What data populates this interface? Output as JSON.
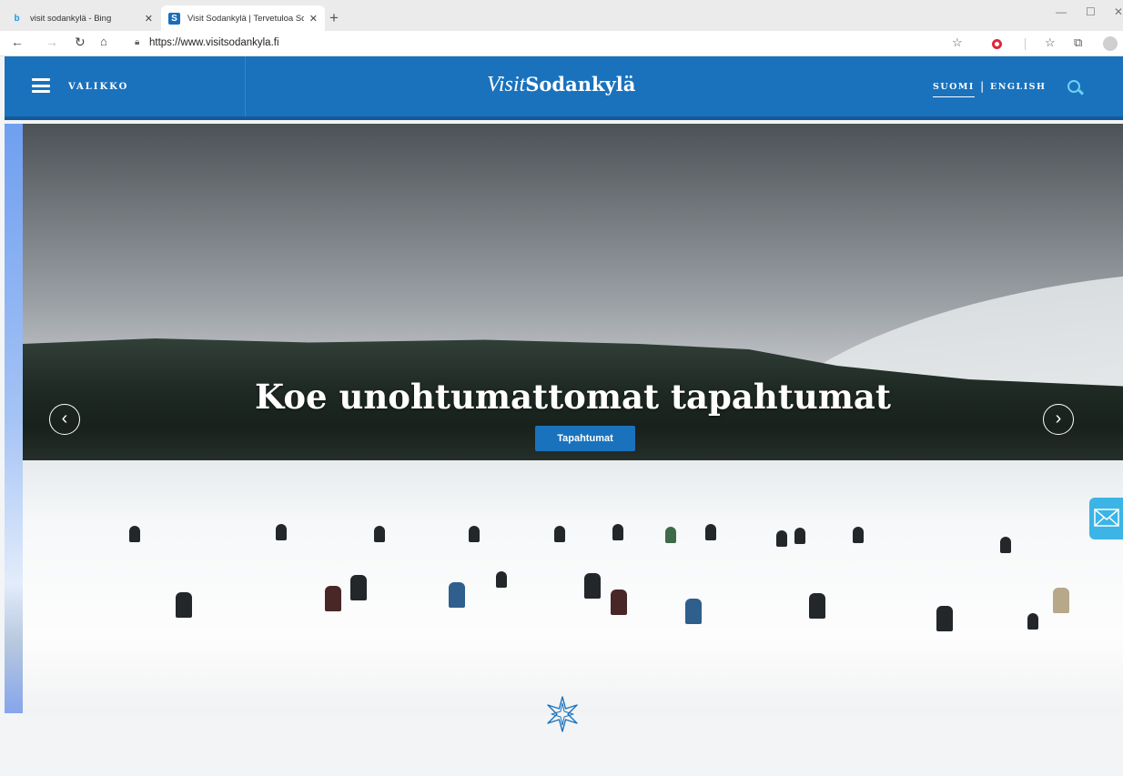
{
  "browser": {
    "tabs": [
      {
        "title": "visit sodankylä - Bing",
        "favicon": "bing-icon",
        "active": false
      },
      {
        "title": "Visit Sodankylä | Tervetuloa Soda",
        "favicon": "s-icon",
        "active": true
      }
    ],
    "url": "https://www.visitsodankyla.fi"
  },
  "header": {
    "menu_label": "VALIKKO",
    "logo_part1": "Visit",
    "logo_part2": "Sodankylä",
    "lang_fi": "SUOMI",
    "lang_sep": "|",
    "lang_en": "ENGLISH"
  },
  "hero": {
    "title": "Koe unohtumattomat tapahtumat",
    "button_label": "Tapahtumat"
  },
  "colors": {
    "brand_blue": "#1a72bd",
    "accent_cyan": "#3cb4e5"
  }
}
